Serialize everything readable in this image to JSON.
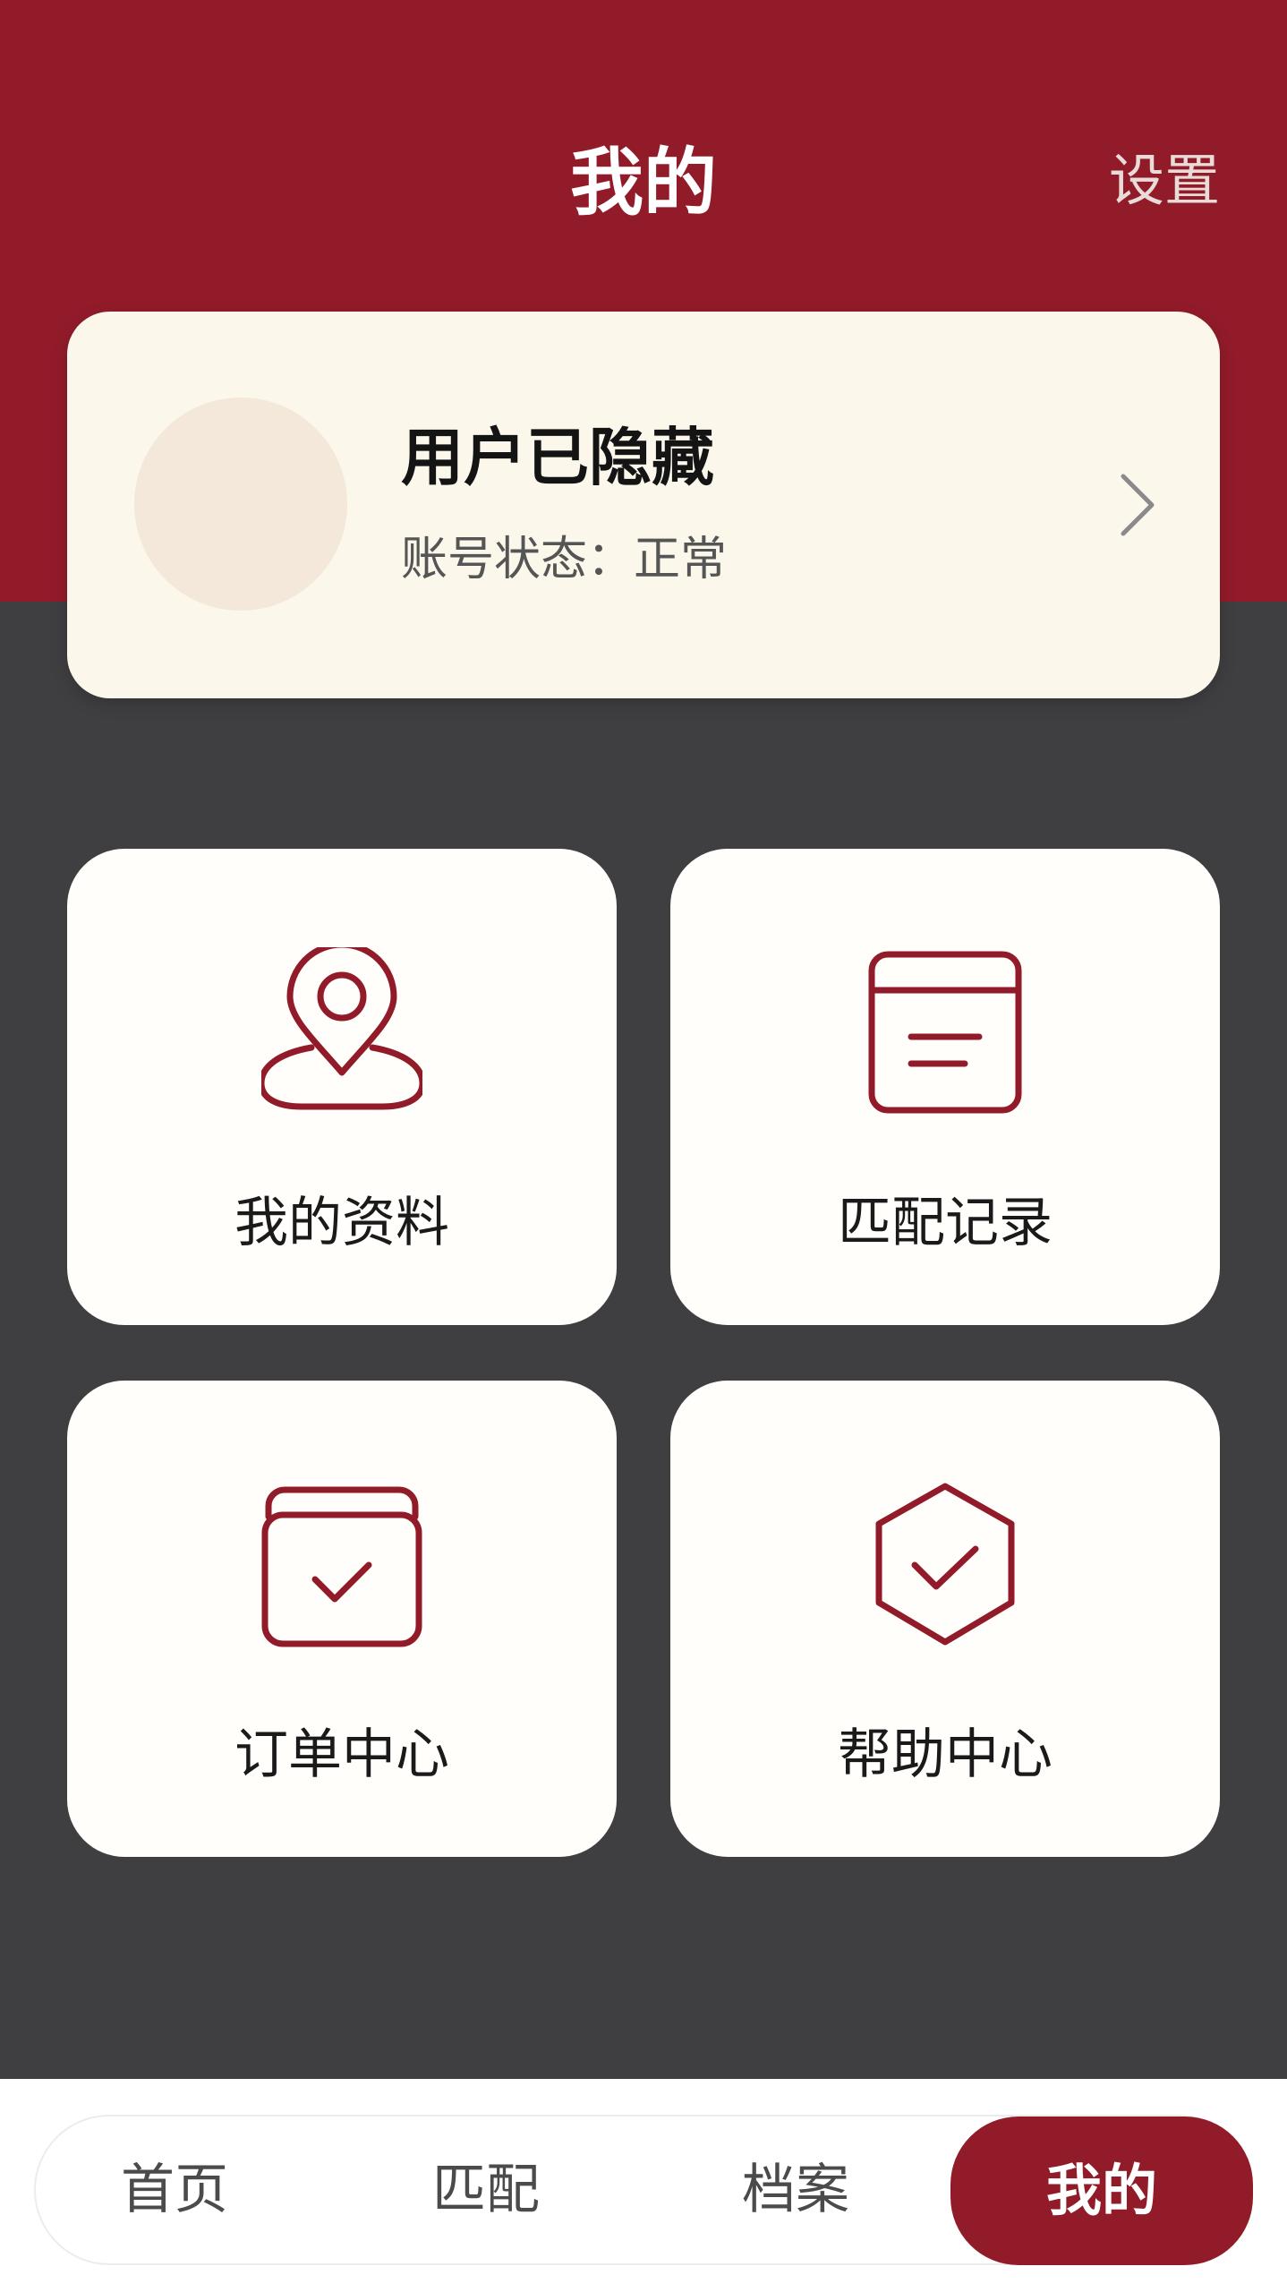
{
  "header": {
    "title": "我的",
    "settings_label": "设置"
  },
  "profile": {
    "name": "用户已隐藏",
    "status": "账号状态：正常"
  },
  "tiles": [
    {
      "label": "我的资料",
      "icon": "location-pin-icon"
    },
    {
      "label": "匹配记录",
      "icon": "record-list-icon"
    },
    {
      "label": "订单中心",
      "icon": "order-check-icon"
    },
    {
      "label": "帮助中心",
      "icon": "shield-check-icon"
    }
  ],
  "tabbar": {
    "items": [
      {
        "label": "首页"
      },
      {
        "label": "匹配"
      },
      {
        "label": "档案"
      },
      {
        "label": "我的",
        "active": true
      }
    ]
  },
  "colors": {
    "brand": "#921b2a",
    "background": "#3f3f41",
    "card": "#fcf7eb",
    "icon_stroke": "#921b2a"
  }
}
